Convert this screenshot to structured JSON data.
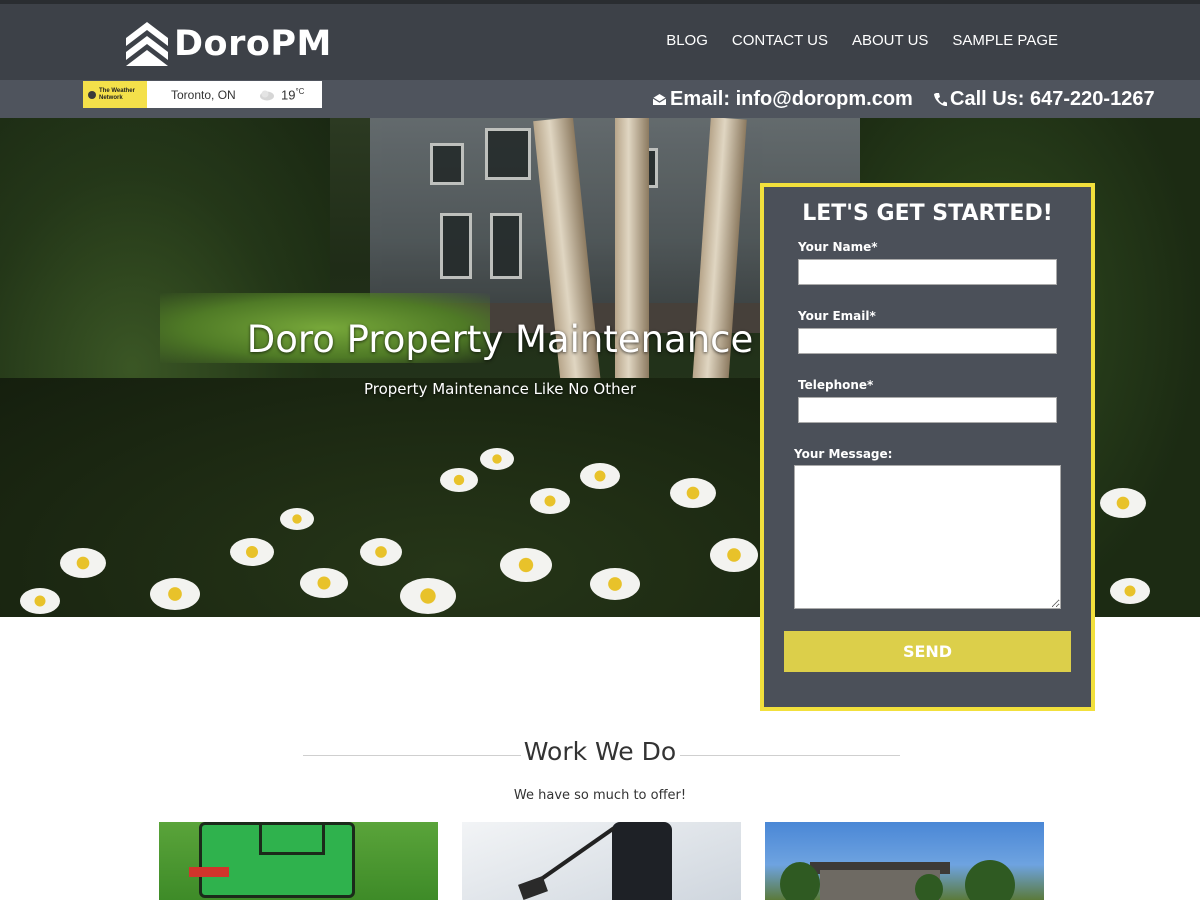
{
  "header": {
    "logo_text": "DoroPM",
    "nav": [
      "BLOG",
      "CONTACT US",
      "ABOUT US",
      "SAMPLE PAGE"
    ]
  },
  "subbar": {
    "weather": {
      "brand": "The Weather Network",
      "city": "Toronto, ON",
      "temp": "19",
      "unit": "°C"
    },
    "email": "Email: info@doropm.com",
    "phone": "Call Us: 647-220-1267"
  },
  "hero": {
    "title": "Doro Property Maintenance",
    "subtitle": "Property Maintenance Like No Other"
  },
  "form": {
    "title": "LET'S GET STARTED!",
    "name_label": "Your Name*",
    "email_label": "Your Email*",
    "phone_label": "Telephone*",
    "message_label": "Your Message:",
    "name_value": "",
    "email_value": "",
    "phone_value": "",
    "message_value": "",
    "send_label": "SEND"
  },
  "work": {
    "title": "Work We Do",
    "subtitle": "We have so much to offer!"
  },
  "colors": {
    "header_bg": "#3d4148",
    "subbar_bg": "#4f545d",
    "form_border": "#f2e03c",
    "send_bg": "#dccf4a"
  },
  "icons": [
    "doropm-logo-icon",
    "envelope-icon",
    "phone-icon",
    "cloud-icon"
  ]
}
